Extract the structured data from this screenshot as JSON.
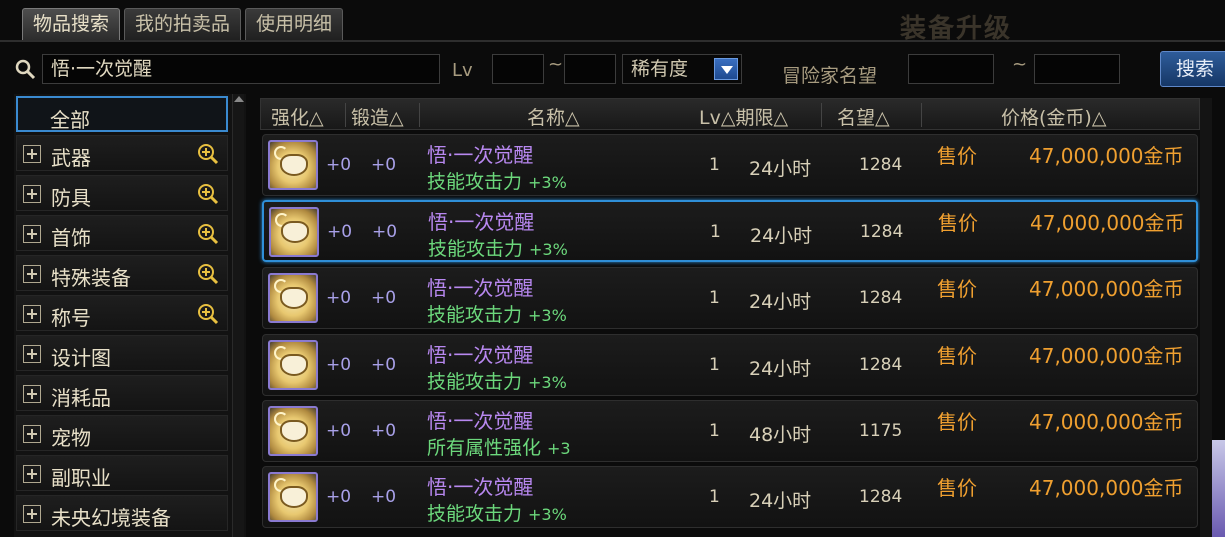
{
  "tabs": [
    {
      "label": "物品搜索"
    },
    {
      "label": "我的拍卖品"
    },
    {
      "label": "使用明细"
    }
  ],
  "background_banner": "装备升级",
  "filter": {
    "search_value": "悟·一次觉醒",
    "lv_label": "Lv",
    "range_sep": "~",
    "rarity_value": "稀有度",
    "fame_label": "冒险家名望",
    "search_button": "搜索"
  },
  "sidebar": {
    "items": [
      {
        "label": "全部"
      },
      {
        "label": "武器"
      },
      {
        "label": "防具"
      },
      {
        "label": "首饰"
      },
      {
        "label": "特殊装备"
      },
      {
        "label": "称号"
      },
      {
        "label": "设计图"
      },
      {
        "label": "消耗品"
      },
      {
        "label": "宠物"
      },
      {
        "label": "副职业"
      },
      {
        "label": "未央幻境装备"
      }
    ]
  },
  "table": {
    "headers": {
      "enhance": "强化△",
      "forge": "锻造△",
      "name": "名称△",
      "lv_period": "Lv△期限△",
      "fame": "名望△",
      "price": "价格(金币)△"
    },
    "rows": [
      {
        "enhance": "+0",
        "forge": "+0",
        "name": "悟·一次觉醒",
        "attr": "技能攻击力",
        "bonus": "+3%",
        "lv": "1",
        "period": "24小时",
        "fame": "1284",
        "sale": "售价",
        "price": "47,000,000金币"
      },
      {
        "enhance": "+0",
        "forge": "+0",
        "name": "悟·一次觉醒",
        "attr": "技能攻击力",
        "bonus": "+3%",
        "lv": "1",
        "period": "24小时",
        "fame": "1284",
        "sale": "售价",
        "price": "47,000,000金币"
      },
      {
        "enhance": "+0",
        "forge": "+0",
        "name": "悟·一次觉醒",
        "attr": "技能攻击力",
        "bonus": "+3%",
        "lv": "1",
        "period": "24小时",
        "fame": "1284",
        "sale": "售价",
        "price": "47,000,000金币"
      },
      {
        "enhance": "+0",
        "forge": "+0",
        "name": "悟·一次觉醒",
        "attr": "技能攻击力",
        "bonus": "+3%",
        "lv": "1",
        "period": "24小时",
        "fame": "1284",
        "sale": "售价",
        "price": "47,000,000金币"
      },
      {
        "enhance": "+0",
        "forge": "+0",
        "name": "悟·一次觉醒",
        "attr": "所有属性强化",
        "bonus": "+3",
        "lv": "1",
        "period": "48小时",
        "fame": "1175",
        "sale": "售价",
        "price": "47,000,000金币"
      },
      {
        "enhance": "+0",
        "forge": "+0",
        "name": "悟·一次觉醒",
        "attr": "技能攻击力",
        "bonus": "+3%",
        "lv": "1",
        "period": "24小时",
        "fame": "1284",
        "sale": "售价",
        "price": "47,000,000金币"
      }
    ]
  },
  "colors": {
    "accent_blue": "#2f8fd8",
    "price_orange": "#f0a030",
    "name_purple": "#b888f0",
    "attr_green": "#6cd87c"
  }
}
